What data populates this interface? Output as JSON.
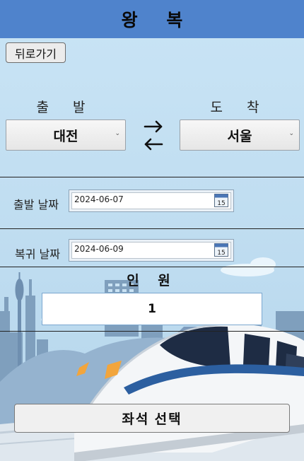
{
  "header": {
    "title": "왕 복"
  },
  "back_button": {
    "label": "뒤로가기"
  },
  "route": {
    "departure": {
      "label": "출 발",
      "value": "대전"
    },
    "arrival": {
      "label": "도 착",
      "value": "서울"
    }
  },
  "dates": {
    "depart": {
      "label": "출발 날짜",
      "value": "2024-06-07"
    },
    "return": {
      "label": "복귀 날짜",
      "value": "2024-06-09"
    }
  },
  "people": {
    "label": "인 원",
    "value": "1"
  },
  "seat_button": {
    "label": "좌석 선택"
  },
  "colors": {
    "header": "#4f83cc",
    "background": "#c3e0f2"
  },
  "icons": [
    "swap-arrows-icon",
    "calendar-icon",
    "chevron-down-icon"
  ]
}
